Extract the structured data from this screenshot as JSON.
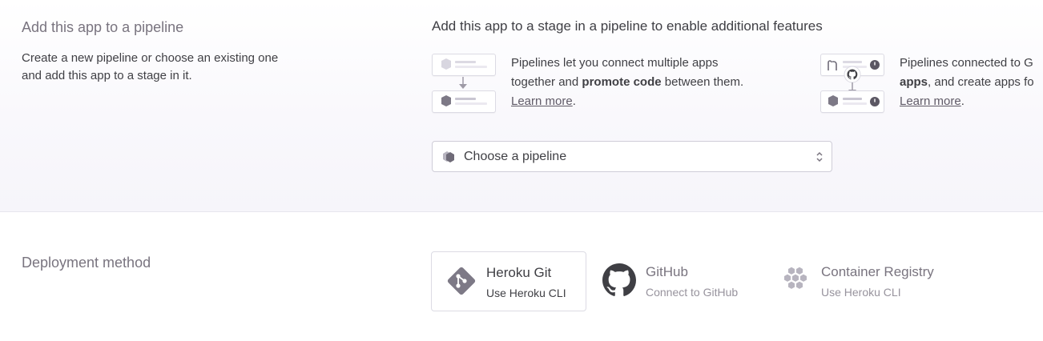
{
  "pipeline": {
    "title": "Add this app to a pipeline",
    "description": "Create a new pipeline or choose an existing one and add this app to a stage in it.",
    "heading": "Add this app to a stage in a pipeline to enable additional features",
    "features": [
      {
        "illustration": "pipeline-promote-icon",
        "line1": "Pipelines let you connect multiple apps",
        "line2_pre": "together and ",
        "line2_bold": "promote code",
        "line2_post": " between them.",
        "link": "Learn more",
        "link_suffix": "."
      },
      {
        "illustration": "pipeline-github-icon",
        "line1": "Pipelines connected to G",
        "line2_bold": "apps",
        "line2_post": ", and create apps fo",
        "link": "Learn more",
        "link_suffix": "."
      }
    ],
    "select": {
      "icon": "pipeline-icon",
      "placeholder": "Choose a pipeline",
      "arrow": "up-down-chevron-icon"
    }
  },
  "deployment": {
    "title": "Deployment method",
    "options": [
      {
        "icon": "heroku-git-icon",
        "name": "Heroku Git",
        "sub": "Use Heroku CLI",
        "selected": true
      },
      {
        "icon": "github-icon",
        "name": "GitHub",
        "sub": "Connect to GitHub",
        "selected": false
      },
      {
        "icon": "container-registry-icon",
        "name": "Container Registry",
        "sub": "Use Heroku CLI",
        "selected": false
      }
    ]
  },
  "colors": {
    "title_gray": "#79747f",
    "text_dark": "#3f3f44",
    "border": "#dcdbe4",
    "icon_purple_gray": "#8e8a96"
  }
}
